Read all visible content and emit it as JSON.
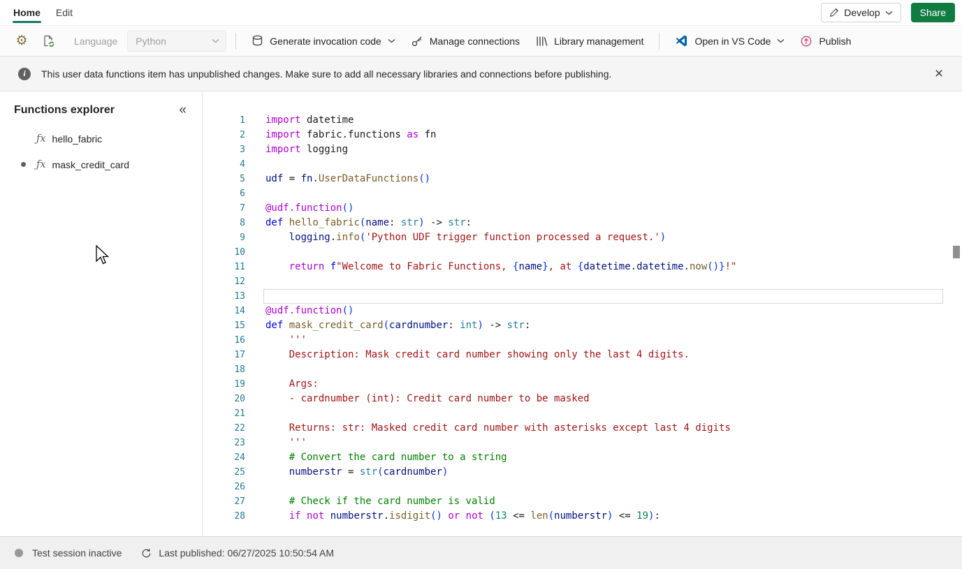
{
  "colors": {
    "accent": "#117865",
    "share": "#107C41",
    "line_number": "#237893"
  },
  "icons": {
    "gear": "⚙",
    "collapse": "«",
    "close": "×",
    "fx": "ƒx"
  },
  "tabs": {
    "home": "Home",
    "edit": "Edit"
  },
  "header": {
    "develop_label": "Develop",
    "share_label": "Share"
  },
  "toolbar": {
    "language_label": "Language",
    "language_value": "Python",
    "generate_label": "Generate invocation code",
    "manage_label": "Manage connections",
    "library_label": "Library management",
    "vscode_label": "Open in VS Code",
    "publish_label": "Publish"
  },
  "banner": {
    "message": "This user data functions item has unpublished changes. Make sure to add all necessary libraries and connections before publishing."
  },
  "explorer": {
    "title": "Functions explorer",
    "items": [
      {
        "label": "hello_fabric",
        "modified": false
      },
      {
        "label": "mask_credit_card",
        "modified": true
      }
    ]
  },
  "editor": {
    "active_line": 13,
    "token_colors": {
      "kw": "#0000FF",
      "kw2": "#AF00DB",
      "dec": "#AF00DB",
      "fn": "#795E26",
      "ty": "#267F99",
      "st": "#A31515",
      "cm": "#008000",
      "nu": "#098658",
      "va": "#001080",
      "pl": "#1b1b1b",
      "br": "#0431FA"
    },
    "lines": [
      {
        "n": 1,
        "tokens": [
          [
            "kw2",
            "import"
          ],
          [
            "pl",
            " datetime"
          ]
        ]
      },
      {
        "n": 2,
        "tokens": [
          [
            "kw2",
            "import"
          ],
          [
            "pl",
            " fabric.functions "
          ],
          [
            "kw2",
            "as"
          ],
          [
            "pl",
            " fn"
          ]
        ]
      },
      {
        "n": 3,
        "tokens": [
          [
            "kw2",
            "import"
          ],
          [
            "pl",
            " logging"
          ]
        ]
      },
      {
        "n": 4,
        "tokens": []
      },
      {
        "n": 5,
        "tokens": [
          [
            "va",
            "udf"
          ],
          [
            "pl",
            " = "
          ],
          [
            "va",
            "fn"
          ],
          [
            "pl",
            "."
          ],
          [
            "fn",
            "UserDataFunctions"
          ],
          [
            "br",
            "()"
          ]
        ]
      },
      {
        "n": 6,
        "tokens": []
      },
      {
        "n": 7,
        "tokens": [
          [
            "dec",
            "@udf.function"
          ],
          [
            "br",
            "()"
          ]
        ]
      },
      {
        "n": 8,
        "tokens": [
          [
            "kw",
            "def"
          ],
          [
            "pl",
            " "
          ],
          [
            "fn",
            "hello_fabric"
          ],
          [
            "br",
            "("
          ],
          [
            "va",
            "name"
          ],
          [
            "pl",
            ": "
          ],
          [
            "ty",
            "str"
          ],
          [
            "br",
            ")"
          ],
          [
            "pl",
            " -> "
          ],
          [
            "ty",
            "str"
          ],
          [
            "pl",
            ":"
          ]
        ]
      },
      {
        "n": 9,
        "tokens": [
          [
            "pl",
            "    "
          ],
          [
            "va",
            "logging"
          ],
          [
            "pl",
            "."
          ],
          [
            "fn",
            "info"
          ],
          [
            "br",
            "("
          ],
          [
            "st",
            "'Python UDF trigger function processed a request.'"
          ],
          [
            "br",
            ")"
          ]
        ]
      },
      {
        "n": 10,
        "tokens": []
      },
      {
        "n": 11,
        "tokens": [
          [
            "pl",
            "    "
          ],
          [
            "kw2",
            "return"
          ],
          [
            "pl",
            " "
          ],
          [
            "kw",
            "f"
          ],
          [
            "st",
            "\"Welcome to Fabric Functions, "
          ],
          [
            "br",
            "{"
          ],
          [
            "va",
            "name"
          ],
          [
            "br",
            "}"
          ],
          [
            "st",
            ", at "
          ],
          [
            "br",
            "{"
          ],
          [
            "va",
            "datetime"
          ],
          [
            "pl",
            "."
          ],
          [
            "va",
            "datetime"
          ],
          [
            "pl",
            "."
          ],
          [
            "fn",
            "now"
          ],
          [
            "br",
            "()"
          ],
          [
            "br",
            "}"
          ],
          [
            "st",
            "!\""
          ]
        ]
      },
      {
        "n": 12,
        "tokens": []
      },
      {
        "n": 13,
        "tokens": []
      },
      {
        "n": 14,
        "tokens": [
          [
            "dec",
            "@udf.function"
          ],
          [
            "br",
            "()"
          ]
        ]
      },
      {
        "n": 15,
        "tokens": [
          [
            "kw",
            "def"
          ],
          [
            "pl",
            " "
          ],
          [
            "fn",
            "mask_credit_card"
          ],
          [
            "br",
            "("
          ],
          [
            "va",
            "cardnumber"
          ],
          [
            "pl",
            ": "
          ],
          [
            "ty",
            "int"
          ],
          [
            "br",
            ")"
          ],
          [
            "pl",
            " -> "
          ],
          [
            "ty",
            "str"
          ],
          [
            "pl",
            ":"
          ]
        ]
      },
      {
        "n": 16,
        "tokens": [
          [
            "st",
            "    '''"
          ]
        ]
      },
      {
        "n": 17,
        "tokens": [
          [
            "st",
            "    Description: Mask credit card number showing only the last 4 digits."
          ]
        ]
      },
      {
        "n": 18,
        "tokens": []
      },
      {
        "n": 19,
        "tokens": [
          [
            "st",
            "    Args:"
          ]
        ]
      },
      {
        "n": 20,
        "tokens": [
          [
            "st",
            "    - cardnumber (int): Credit card number to be masked"
          ]
        ]
      },
      {
        "n": 21,
        "tokens": []
      },
      {
        "n": 22,
        "tokens": [
          [
            "st",
            "    Returns: str: Masked credit card number with asterisks except last 4 digits"
          ]
        ]
      },
      {
        "n": 23,
        "tokens": [
          [
            "st",
            "    '''"
          ]
        ]
      },
      {
        "n": 24,
        "tokens": [
          [
            "cm",
            "    # Convert the card number to a string"
          ]
        ]
      },
      {
        "n": 25,
        "tokens": [
          [
            "pl",
            "    "
          ],
          [
            "va",
            "numberstr"
          ],
          [
            "pl",
            " = "
          ],
          [
            "ty",
            "str"
          ],
          [
            "br",
            "("
          ],
          [
            "va",
            "cardnumber"
          ],
          [
            "br",
            ")"
          ]
        ]
      },
      {
        "n": 26,
        "tokens": []
      },
      {
        "n": 27,
        "tokens": [
          [
            "cm",
            "    # Check if the card number is valid"
          ]
        ]
      },
      {
        "n": 28,
        "tokens": [
          [
            "pl",
            "    "
          ],
          [
            "kw2",
            "if"
          ],
          [
            "pl",
            " "
          ],
          [
            "kw2",
            "not"
          ],
          [
            "pl",
            " "
          ],
          [
            "va",
            "numberstr"
          ],
          [
            "pl",
            "."
          ],
          [
            "fn",
            "isdigit"
          ],
          [
            "br",
            "()"
          ],
          [
            "pl",
            " "
          ],
          [
            "kw2",
            "or"
          ],
          [
            "pl",
            " "
          ],
          [
            "kw2",
            "not"
          ],
          [
            "pl",
            " "
          ],
          [
            "br",
            "("
          ],
          [
            "nu",
            "13"
          ],
          [
            "pl",
            " <= "
          ],
          [
            "fn",
            "len"
          ],
          [
            "br",
            "("
          ],
          [
            "va",
            "numberstr"
          ],
          [
            "br",
            ")"
          ],
          [
            "pl",
            " <= "
          ],
          [
            "nu",
            "19"
          ],
          [
            "br",
            ")"
          ],
          [
            "pl",
            ":"
          ]
        ]
      }
    ]
  },
  "statusbar": {
    "session": "Test session inactive",
    "last_published": "Last published: 06/27/2025 10:50:54 AM"
  }
}
